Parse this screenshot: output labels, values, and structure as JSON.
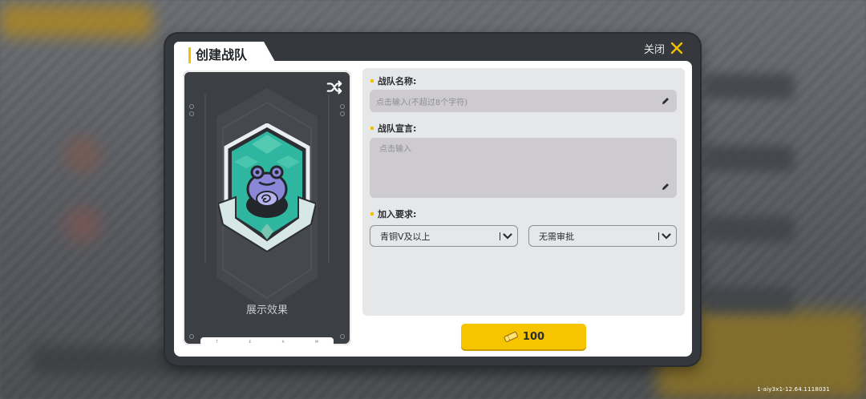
{
  "modal": {
    "title": "创建战队",
    "close_label": "关闭"
  },
  "preview": {
    "label": "展示效果",
    "strip_letters": [
      "T",
      "E",
      "A",
      "M"
    ],
    "shuffle_icon": "shuffle-icon",
    "emblem_icon": "frog-emblem-icon"
  },
  "form": {
    "name_label": "战队名称:",
    "name_placeholder": "点击输入(不超过8个字符)",
    "declaration_label": "战队宣言:",
    "declaration_placeholder": "点击输入",
    "requirement_label": "加入要求:",
    "level_select_value": "青铜V及以上",
    "approval_select_value": "无需审批"
  },
  "create_button": {
    "cost": "100",
    "currency_icon": "gold-ticket-icon"
  },
  "version": "1-aiy3x1-12.64.1118031",
  "colors": {
    "accent": "#f7c400",
    "panel": "#e6e7e8",
    "frame": "#35383d",
    "emblem_teal": "#2fb6a0",
    "emblem_purple": "#8a86d8"
  }
}
